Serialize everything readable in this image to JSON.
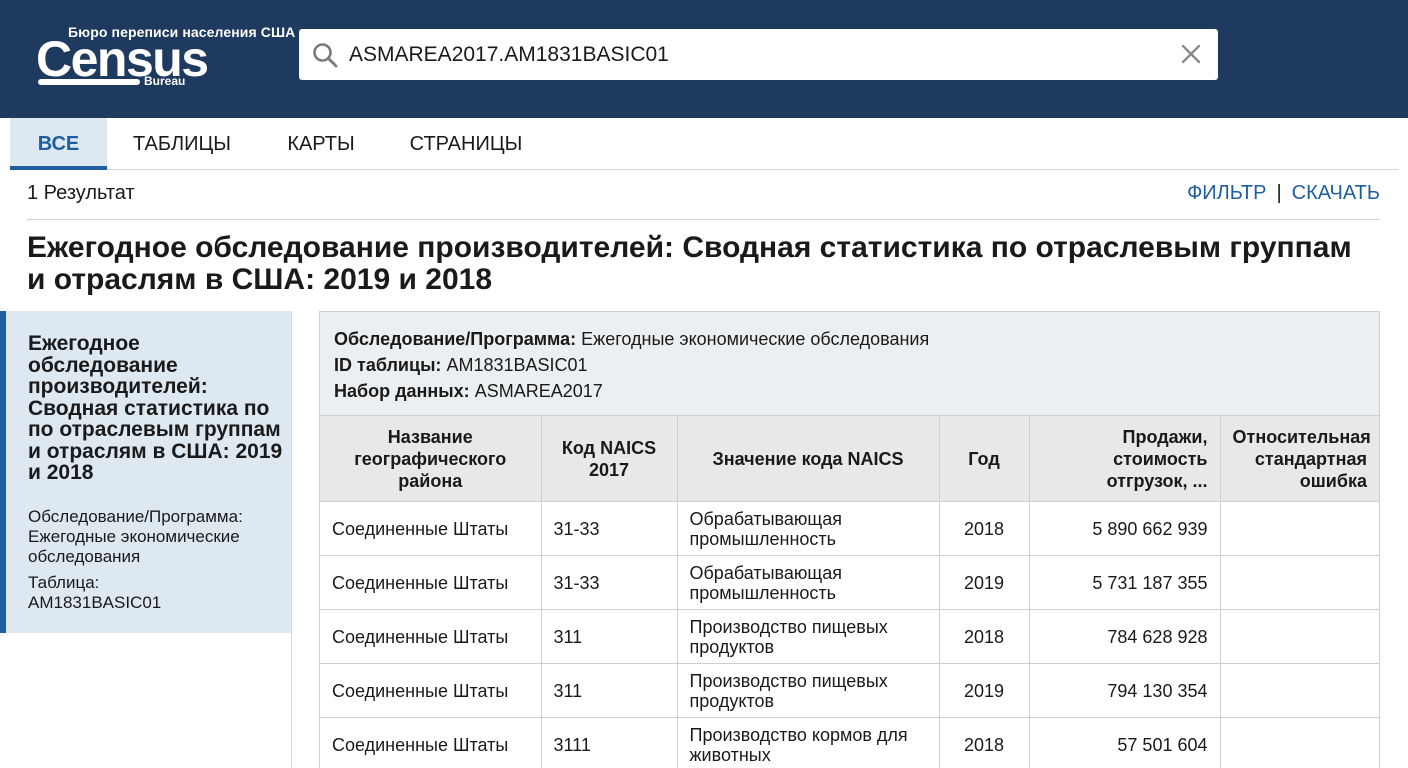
{
  "header": {
    "logo_tagline": "Бюро переписи населения США",
    "logo_main": "Census",
    "logo_sub": "Bureau",
    "search_value": "ASMAREA2017.AM1831BASIC01",
    "brand_color": "#1f3a5f"
  },
  "tabs": [
    {
      "label": "ВСЕ",
      "active": true
    },
    {
      "label": "ТАБЛИЦЫ",
      "active": false
    },
    {
      "label": "КАРТЫ",
      "active": false
    },
    {
      "label": "СТРАНИЦЫ",
      "active": false
    }
  ],
  "results": {
    "count_label": "1 Результат",
    "filter_label": "ФИЛЬТР",
    "separator": "|",
    "download_label": "СКАЧАТЬ"
  },
  "main_title": "Ежегодное обследование производителей: Сводная статистика по отраслевым группам и отраслям в США: 2019 и 2018",
  "sidebar": {
    "title": "Ежегодное обследование производителей: Сводная статистика по по отраслевым группам и отраслям в США: 2019 и 2018",
    "program_label": "Обследование/Программа:",
    "program_value": "Ежегодные экономические обследования",
    "table_label": "Таблица:",
    "table_value": "AM1831BASIC01"
  },
  "panel": {
    "program_label": "Обследование/Программа:",
    "program_value": "Ежегодные экономические обследования",
    "table_id_label": "ID таблицы:",
    "table_id_value": "AM1831BASIC01",
    "dataset_label": "Набор данных:",
    "dataset_value": "ASMAREA2017"
  },
  "table": {
    "headers": [
      "Название географического района",
      "Код NAICS 2017",
      "Значение кода NAICS",
      "Год",
      "Продажи, стоимость отгрузок, ...",
      "Относительная стандартная ошибка"
    ],
    "rows": [
      {
        "geo": "Соединенные Штаты",
        "code": "31-33",
        "meaning": "Обрабатывающая промышленность",
        "year": "2018",
        "sales": "5 890 662 939",
        "rse": ""
      },
      {
        "geo": "Соединенные Штаты",
        "code": "31-33",
        "meaning": "Обрабатывающая промышленность",
        "year": "2019",
        "sales": "5 731 187 355",
        "rse": ""
      },
      {
        "geo": "Соединенные Штаты",
        "code": "311",
        "meaning": "Производство пищевых продуктов",
        "year": "2018",
        "sales": "784 628 928",
        "rse": ""
      },
      {
        "geo": "Соединенные Штаты",
        "code": "311",
        "meaning": "Производство пищевых продуктов",
        "year": "2019",
        "sales": "794 130 354",
        "rse": ""
      },
      {
        "geo": "Соединенные Штаты",
        "code": "3111",
        "meaning": "Производство кормов для животных",
        "year": "2018",
        "sales": "57 501 604",
        "rse": ""
      }
    ]
  }
}
